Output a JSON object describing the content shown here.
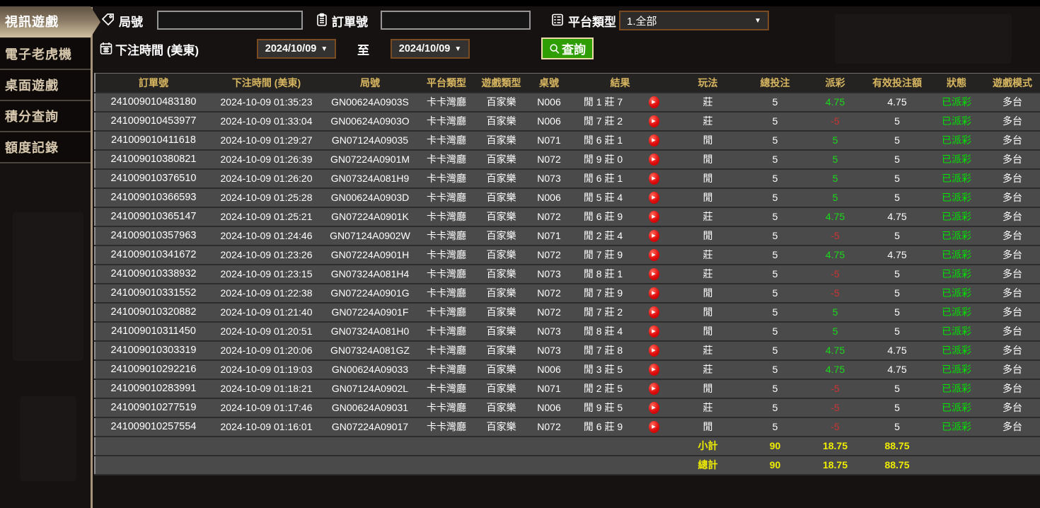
{
  "colors": {
    "accent_gold": "#d8b660",
    "sidebar_tan": "#d6c7ad",
    "active_tab_light": "#cfc0a1",
    "row_bg": "#4a4a4a",
    "positive_green": "#19da19",
    "status_green": "#00e400",
    "negative_red": "#cc3434",
    "totals_yellow": "#f0ee00",
    "search_green": "#2f9e04",
    "picker_border": "#7a4a20"
  },
  "glyphs": {
    "dropdown": "▼",
    "play": "▶"
  },
  "sidebar": {
    "items": [
      {
        "label": "視訊遊戲",
        "active": true
      },
      {
        "label": "電子老虎機",
        "active": false
      },
      {
        "label": "桌面遊戲",
        "active": false
      },
      {
        "label": "積分查詢",
        "active": false
      },
      {
        "label": "額度記錄",
        "active": false
      }
    ]
  },
  "filters": {
    "round_label": "局號",
    "round_value": "",
    "order_label": "訂單號",
    "order_value": "",
    "platform_label": "平台類型",
    "platform_value": "1.全部",
    "bet_time_label": "下注時間 (美東)",
    "date_from": "2024/10/09",
    "to_label": "至",
    "date_to": "2024/10/09",
    "search_label": "查詢"
  },
  "table": {
    "headers": [
      "訂單號",
      "下注時間 (美東)",
      "局號",
      "平台類型",
      "遊戲類型",
      "桌號",
      "結果",
      "玩法",
      "總投注",
      "派彩",
      "有效投注額",
      "狀態",
      "遊戲模式"
    ],
    "rows": [
      {
        "order": "241009010483180",
        "time": "2024-10-09 01:35:23",
        "round": "GN00624A0903S",
        "platform": "卡卡灣廳",
        "game": "百家樂",
        "tableNo": "N006",
        "result": "閒 1 莊 7",
        "play": "莊",
        "bet": "5",
        "payout": "4.75",
        "valid": "4.75",
        "status": "已派彩",
        "mode": "多台"
      },
      {
        "order": "241009010453977",
        "time": "2024-10-09 01:33:04",
        "round": "GN00624A0903O",
        "platform": "卡卡灣廳",
        "game": "百家樂",
        "tableNo": "N006",
        "result": "閒 7 莊 2",
        "play": "莊",
        "bet": "5",
        "payout": "-5",
        "valid": "5",
        "status": "已派彩",
        "mode": "多台"
      },
      {
        "order": "241009010411618",
        "time": "2024-10-09 01:29:27",
        "round": "GN07124A09035",
        "platform": "卡卡灣廳",
        "game": "百家樂",
        "tableNo": "N071",
        "result": "閒 6 莊 1",
        "play": "閒",
        "bet": "5",
        "payout": "5",
        "valid": "5",
        "status": "已派彩",
        "mode": "多台"
      },
      {
        "order": "241009010380821",
        "time": "2024-10-09 01:26:39",
        "round": "GN07224A0901M",
        "platform": "卡卡灣廳",
        "game": "百家樂",
        "tableNo": "N072",
        "result": "閒 9 莊 0",
        "play": "閒",
        "bet": "5",
        "payout": "5",
        "valid": "5",
        "status": "已派彩",
        "mode": "多台"
      },
      {
        "order": "241009010376510",
        "time": "2024-10-09 01:26:20",
        "round": "GN07324A081H9",
        "platform": "卡卡灣廳",
        "game": "百家樂",
        "tableNo": "N073",
        "result": "閒 6 莊 1",
        "play": "閒",
        "bet": "5",
        "payout": "5",
        "valid": "5",
        "status": "已派彩",
        "mode": "多台"
      },
      {
        "order": "241009010366593",
        "time": "2024-10-09 01:25:28",
        "round": "GN00624A0903D",
        "platform": "卡卡灣廳",
        "game": "百家樂",
        "tableNo": "N006",
        "result": "閒 5 莊 4",
        "play": "閒",
        "bet": "5",
        "payout": "5",
        "valid": "5",
        "status": "已派彩",
        "mode": "多台"
      },
      {
        "order": "241009010365147",
        "time": "2024-10-09 01:25:21",
        "round": "GN07224A0901K",
        "platform": "卡卡灣廳",
        "game": "百家樂",
        "tableNo": "N072",
        "result": "閒 6 莊 9",
        "play": "莊",
        "bet": "5",
        "payout": "4.75",
        "valid": "4.75",
        "status": "已派彩",
        "mode": "多台"
      },
      {
        "order": "241009010357963",
        "time": "2024-10-09 01:24:46",
        "round": "GN07124A0902W",
        "platform": "卡卡灣廳",
        "game": "百家樂",
        "tableNo": "N071",
        "result": "閒 2 莊 4",
        "play": "閒",
        "bet": "5",
        "payout": "-5",
        "valid": "5",
        "status": "已派彩",
        "mode": "多台"
      },
      {
        "order": "241009010341672",
        "time": "2024-10-09 01:23:26",
        "round": "GN07224A0901H",
        "platform": "卡卡灣廳",
        "game": "百家樂",
        "tableNo": "N072",
        "result": "閒 7 莊 9",
        "play": "莊",
        "bet": "5",
        "payout": "4.75",
        "valid": "4.75",
        "status": "已派彩",
        "mode": "多台"
      },
      {
        "order": "241009010338932",
        "time": "2024-10-09 01:23:15",
        "round": "GN07324A081H4",
        "platform": "卡卡灣廳",
        "game": "百家樂",
        "tableNo": "N073",
        "result": "閒 8 莊 1",
        "play": "莊",
        "bet": "5",
        "payout": "-5",
        "valid": "5",
        "status": "已派彩",
        "mode": "多台"
      },
      {
        "order": "241009010331552",
        "time": "2024-10-09 01:22:38",
        "round": "GN07224A0901G",
        "platform": "卡卡灣廳",
        "game": "百家樂",
        "tableNo": "N072",
        "result": "閒 7 莊 9",
        "play": "閒",
        "bet": "5",
        "payout": "-5",
        "valid": "5",
        "status": "已派彩",
        "mode": "多台"
      },
      {
        "order": "241009010320882",
        "time": "2024-10-09 01:21:40",
        "round": "GN07224A0901F",
        "platform": "卡卡灣廳",
        "game": "百家樂",
        "tableNo": "N072",
        "result": "閒 7 莊 2",
        "play": "閒",
        "bet": "5",
        "payout": "5",
        "valid": "5",
        "status": "已派彩",
        "mode": "多台"
      },
      {
        "order": "241009010311450",
        "time": "2024-10-09 01:20:51",
        "round": "GN07324A081H0",
        "platform": "卡卡灣廳",
        "game": "百家樂",
        "tableNo": "N073",
        "result": "閒 8 莊 4",
        "play": "閒",
        "bet": "5",
        "payout": "5",
        "valid": "5",
        "status": "已派彩",
        "mode": "多台"
      },
      {
        "order": "241009010303319",
        "time": "2024-10-09 01:20:06",
        "round": "GN07324A081GZ",
        "platform": "卡卡灣廳",
        "game": "百家樂",
        "tableNo": "N073",
        "result": "閒 7 莊 8",
        "play": "莊",
        "bet": "5",
        "payout": "4.75",
        "valid": "4.75",
        "status": "已派彩",
        "mode": "多台"
      },
      {
        "order": "241009010292216",
        "time": "2024-10-09 01:19:03",
        "round": "GN00624A09033",
        "platform": "卡卡灣廳",
        "game": "百家樂",
        "tableNo": "N006",
        "result": "閒 3 莊 5",
        "play": "莊",
        "bet": "5",
        "payout": "4.75",
        "valid": "4.75",
        "status": "已派彩",
        "mode": "多台"
      },
      {
        "order": "241009010283991",
        "time": "2024-10-09 01:18:21",
        "round": "GN07124A0902L",
        "platform": "卡卡灣廳",
        "game": "百家樂",
        "tableNo": "N071",
        "result": "閒 2 莊 5",
        "play": "閒",
        "bet": "5",
        "payout": "-5",
        "valid": "5",
        "status": "已派彩",
        "mode": "多台"
      },
      {
        "order": "241009010277519",
        "time": "2024-10-09 01:17:46",
        "round": "GN00624A09031",
        "platform": "卡卡灣廳",
        "game": "百家樂",
        "tableNo": "N006",
        "result": "閒 9 莊 5",
        "play": "莊",
        "bet": "5",
        "payout": "-5",
        "valid": "5",
        "status": "已派彩",
        "mode": "多台"
      },
      {
        "order": "241009010257554",
        "time": "2024-10-09 01:16:01",
        "round": "GN07224A09017",
        "platform": "卡卡灣廳",
        "game": "百家樂",
        "tableNo": "N072",
        "result": "閒 6 莊 9",
        "play": "閒",
        "bet": "5",
        "payout": "-5",
        "valid": "5",
        "status": "已派彩",
        "mode": "多台"
      }
    ],
    "subtotal": {
      "label": "小計",
      "bet": "90",
      "payout": "18.75",
      "valid": "88.75"
    },
    "total": {
      "label": "總計",
      "bet": "90",
      "payout": "18.75",
      "valid": "88.75"
    }
  }
}
